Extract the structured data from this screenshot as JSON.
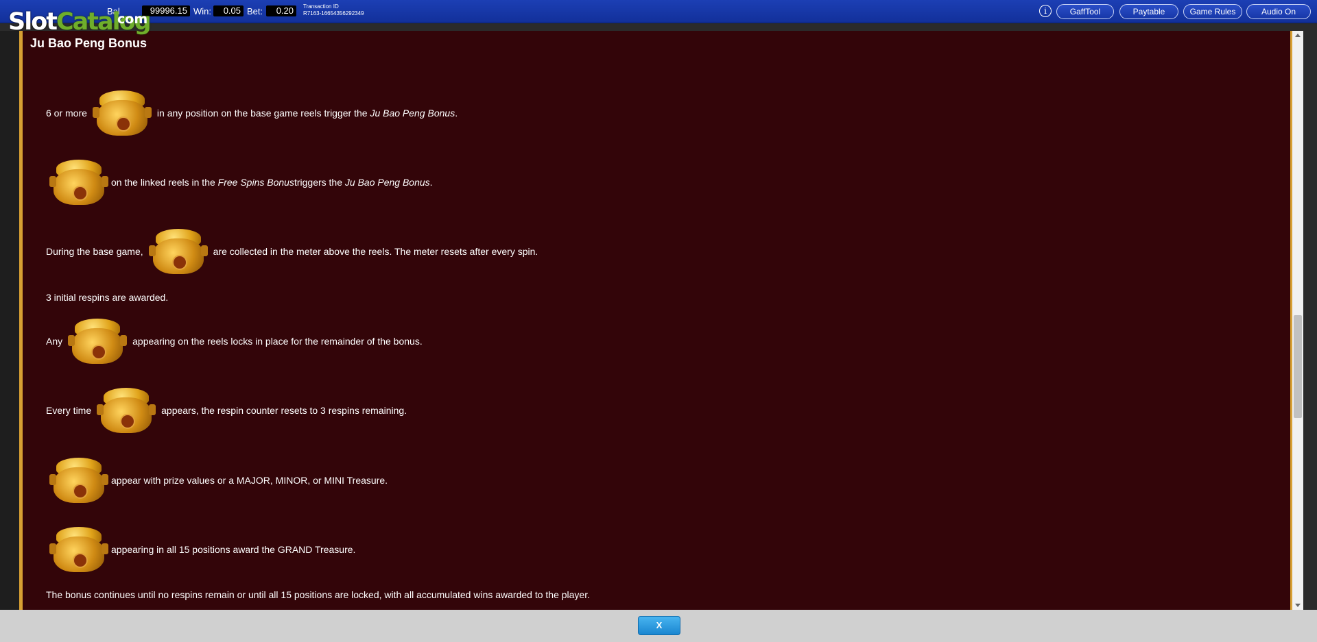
{
  "logo": {
    "part1": "Slot",
    "part2": "Catalog",
    "suffix": "com"
  },
  "header": {
    "balance_label": "Bal",
    "balance_value": "99996.15",
    "win_label": "Win:",
    "win_value": "0.05",
    "bet_label": "Bet:",
    "bet_value": "0.20",
    "transaction_label": "Transaction ID",
    "transaction_value": "R7163-16654356292349",
    "buttons": [
      "GaffTool",
      "Paytable",
      "Game Rules",
      "Audio On"
    ]
  },
  "content": {
    "title": "Ju Bao Peng Bonus",
    "lines": [
      {
        "pre": "6 or more",
        "post_a": "in any position on the base game reels trigger the ",
        "post_em": "Ju Bao Peng Bonus",
        "post_b": "."
      },
      {
        "pre": "",
        "post_a": "on the linked reels in the ",
        "post_em": "Free Spins Bonus",
        "post_mid": " triggers the ",
        "post_em2": "Ju Bao Peng Bonus",
        "post_b": "."
      },
      {
        "pre": "During the base game,",
        "post_a": "are collected in the meter above the reels. The meter resets after every spin."
      },
      {
        "text": "3 initial respins are awarded."
      },
      {
        "pre": "Any",
        "post_a": "appearing on the reels locks in place for the remainder of the bonus."
      },
      {
        "pre": "Every time",
        "post_a": "appears, the respin counter resets to 3 respins remaining."
      },
      {
        "pre": "",
        "post_a": "appear with prize values or a MAJOR, MINOR, or MINI Treasure."
      },
      {
        "pre": "",
        "post_a": "appearing in all 15 positions award the GRAND Treasure."
      },
      {
        "text": "The bonus continues until no respins remain or until all 15 positions are locked, with all accumulated wins awarded to the player."
      }
    ]
  },
  "footer": {
    "close_label": "X"
  },
  "colors": {
    "background": "#330509",
    "border": "#d8a033",
    "topbar": "#1c3fb4"
  }
}
